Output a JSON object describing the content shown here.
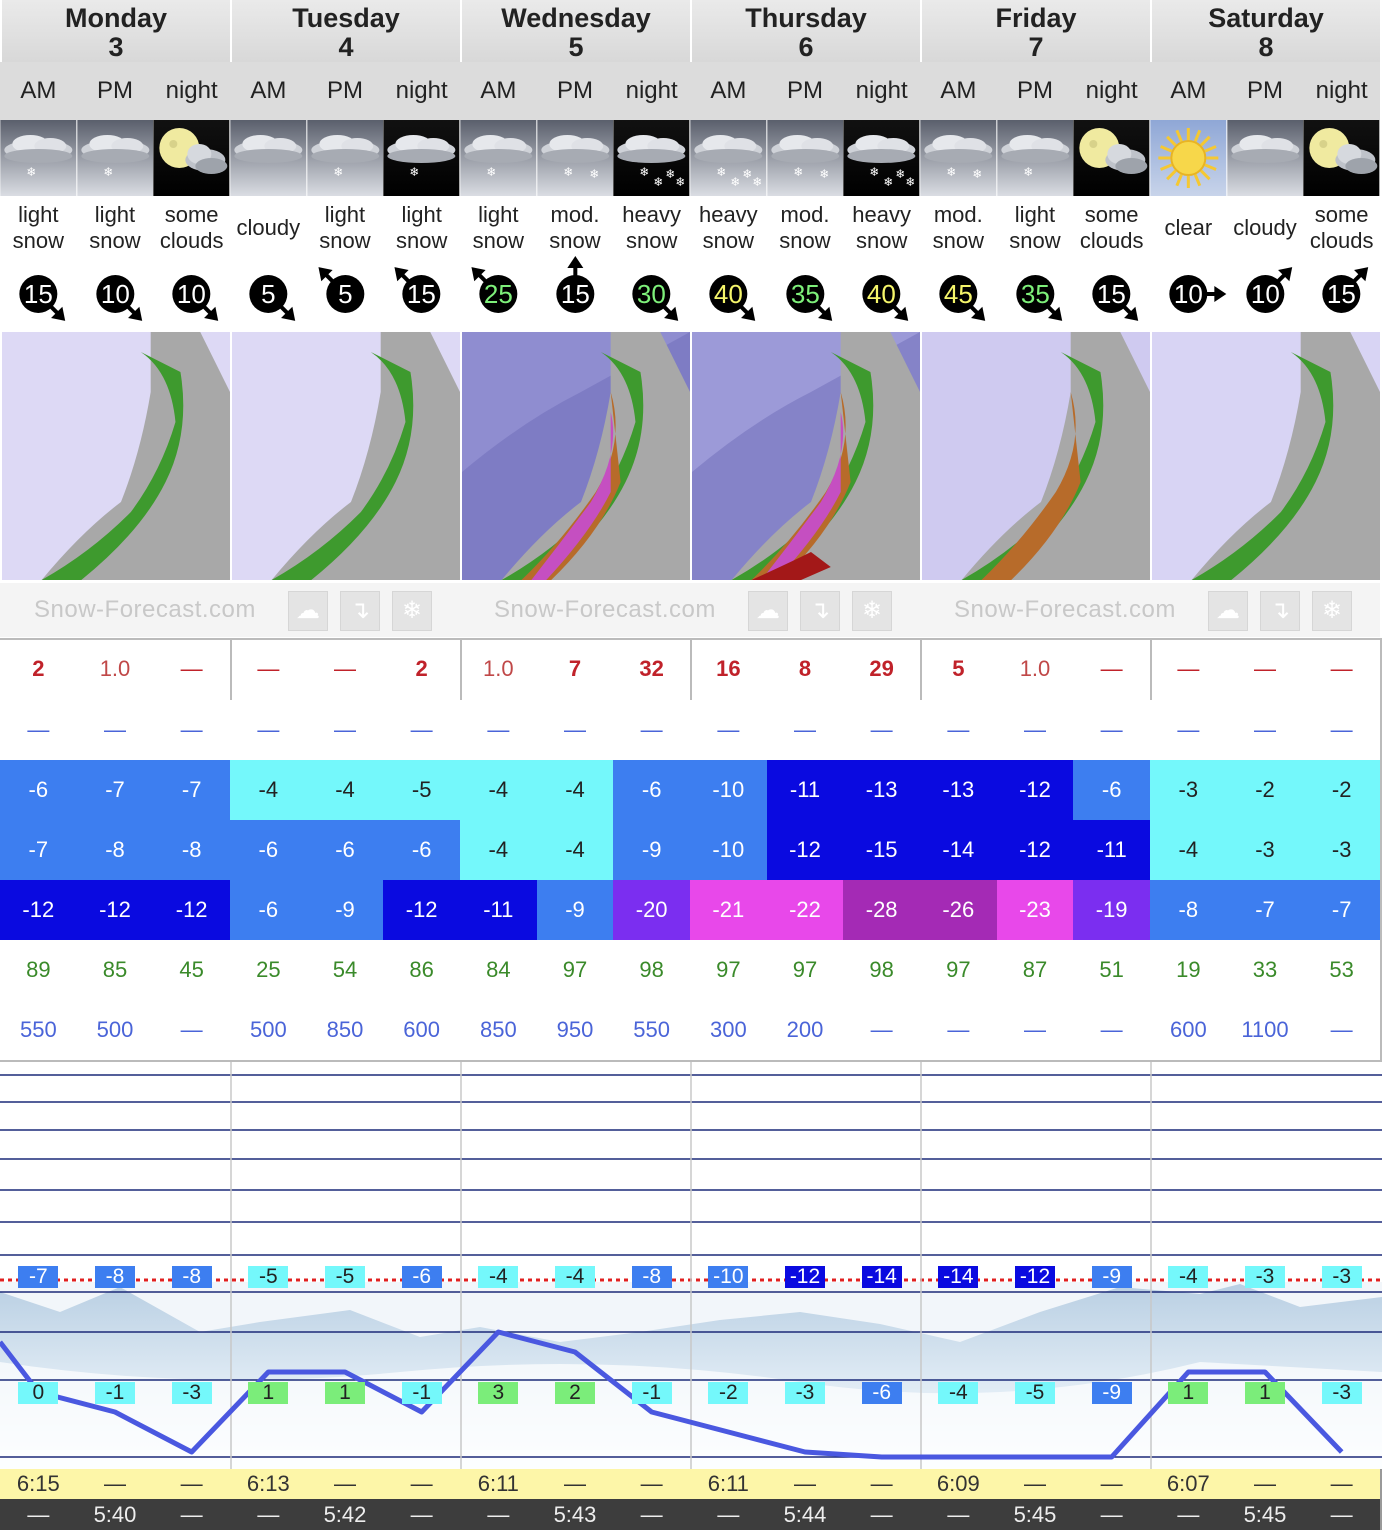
{
  "days": [
    {
      "name": "Monday",
      "date": "3",
      "periods": [
        "AM",
        "PM",
        "night"
      ],
      "weather": [
        "light\nsnow",
        "light\nsnow",
        "some\nclouds"
      ],
      "icons": [
        "light-snow-icon",
        "light-snow-icon",
        "night-clouds-icon"
      ],
      "wind": [
        15,
        10,
        10
      ],
      "wind_dir": [
        "SE",
        "SE",
        "SE"
      ],
      "snow": [
        "2",
        "1.0",
        "—"
      ],
      "rain": [
        "—",
        "—",
        "—"
      ],
      "max_temp": [
        "-6",
        "-7",
        "-7"
      ],
      "min_temp": [
        "-7",
        "-8",
        "-8"
      ],
      "chill": [
        "-12",
        "-12",
        "-12"
      ],
      "humidity": [
        "89",
        "85",
        "45"
      ],
      "freeze": [
        "550",
        "500",
        "—"
      ],
      "summit": [
        "-7",
        "-8",
        "-8"
      ],
      "base": [
        "0",
        "-1",
        "-3"
      ],
      "sunrise": "6:15",
      "sunset": "5:40"
    },
    {
      "name": "Tuesday",
      "date": "4",
      "periods": [
        "AM",
        "PM",
        "night"
      ],
      "weather": [
        "cloudy",
        "light\nsnow",
        "light\nsnow"
      ],
      "icons": [
        "cloudy-icon",
        "light-snow-icon",
        "night-snow-icon"
      ],
      "wind": [
        5,
        5,
        15
      ],
      "wind_dir": [
        "SE",
        "NW",
        "NW"
      ],
      "snow": [
        "—",
        "—",
        "2"
      ],
      "rain": [
        "—",
        "—",
        "—"
      ],
      "max_temp": [
        "-4",
        "-4",
        "-5"
      ],
      "min_temp": [
        "-6",
        "-6",
        "-6"
      ],
      "chill": [
        "-6",
        "-9",
        "-12"
      ],
      "humidity": [
        "25",
        "54",
        "86"
      ],
      "freeze": [
        "500",
        "850",
        "600"
      ],
      "summit": [
        "-5",
        "-5",
        "-6"
      ],
      "base": [
        "1",
        "1",
        "-1"
      ],
      "sunrise": "6:13",
      "sunset": "5:42"
    },
    {
      "name": "Wednesday",
      "date": "5",
      "periods": [
        "AM",
        "PM",
        "night"
      ],
      "weather": [
        "light\nsnow",
        "mod.\nsnow",
        "heavy\nsnow"
      ],
      "icons": [
        "light-snow-icon",
        "mod-snow-icon",
        "night-heavy-snow-icon"
      ],
      "wind": [
        25,
        15,
        30
      ],
      "wind_dir": [
        "NW",
        "N",
        "SE"
      ],
      "snow": [
        "1.0",
        "7",
        "32"
      ],
      "rain": [
        "—",
        "—",
        "—"
      ],
      "max_temp": [
        "-4",
        "-4",
        "-6"
      ],
      "min_temp": [
        "-4",
        "-4",
        "-9"
      ],
      "chill": [
        "-11",
        "-9",
        "-20"
      ],
      "humidity": [
        "84",
        "97",
        "98"
      ],
      "freeze": [
        "850",
        "950",
        "550"
      ],
      "summit": [
        "-4",
        "-4",
        "-8"
      ],
      "base": [
        "3",
        "2",
        "-1"
      ],
      "sunrise": "6:11",
      "sunset": "5:43"
    },
    {
      "name": "Thursday",
      "date": "6",
      "periods": [
        "AM",
        "PM",
        "night"
      ],
      "weather": [
        "heavy\nsnow",
        "mod.\nsnow",
        "heavy\nsnow"
      ],
      "icons": [
        "heavy-snow-icon",
        "mod-snow-icon",
        "night-heavy-snow-icon"
      ],
      "wind": [
        40,
        35,
        40
      ],
      "wind_dir": [
        "SE",
        "SE",
        "SE"
      ],
      "snow": [
        "16",
        "8",
        "29"
      ],
      "rain": [
        "—",
        "—",
        "—"
      ],
      "max_temp": [
        "-10",
        "-11",
        "-13"
      ],
      "min_temp": [
        "-10",
        "-12",
        "-15"
      ],
      "chill": [
        "-21",
        "-22",
        "-28"
      ],
      "humidity": [
        "97",
        "97",
        "98"
      ],
      "freeze": [
        "300",
        "200",
        "—"
      ],
      "summit": [
        "-10",
        "-12",
        "-14"
      ],
      "base": [
        "-2",
        "-3",
        "-6"
      ],
      "sunrise": "6:11",
      "sunset": "5:44"
    },
    {
      "name": "Friday",
      "date": "7",
      "periods": [
        "AM",
        "PM",
        "night"
      ],
      "weather": [
        "mod.\nsnow",
        "light\nsnow",
        "some\nclouds"
      ],
      "icons": [
        "mod-snow-icon",
        "light-snow-icon",
        "night-clouds-icon"
      ],
      "wind": [
        45,
        35,
        15
      ],
      "wind_dir": [
        "SE",
        "SE",
        "SE"
      ],
      "snow": [
        "5",
        "1.0",
        "—"
      ],
      "rain": [
        "—",
        "—",
        "—"
      ],
      "max_temp": [
        "-13",
        "-12",
        "-6"
      ],
      "min_temp": [
        "-14",
        "-12",
        "-11"
      ],
      "chill": [
        "-26",
        "-23",
        "-19"
      ],
      "humidity": [
        "97",
        "87",
        "51"
      ],
      "freeze": [
        "—",
        "—",
        "—"
      ],
      "summit": [
        "-14",
        "-12",
        "-9"
      ],
      "base": [
        "-4",
        "-5",
        "-9"
      ],
      "sunrise": "6:09",
      "sunset": "5:45"
    },
    {
      "name": "Saturday",
      "date": "8",
      "periods": [
        "AM",
        "PM",
        "night"
      ],
      "weather": [
        "clear",
        "cloudy",
        "some\nclouds"
      ],
      "icons": [
        "sun-icon",
        "cloudy-icon",
        "night-clouds-icon"
      ],
      "wind": [
        10,
        10,
        15
      ],
      "wind_dir": [
        "E",
        "NE",
        "NE"
      ],
      "snow": [
        "—",
        "—",
        "—"
      ],
      "rain": [
        "—",
        "—",
        "—"
      ],
      "max_temp": [
        "-3",
        "-2",
        "-2"
      ],
      "min_temp": [
        "-4",
        "-3",
        "-3"
      ],
      "chill": [
        "-8",
        "-7",
        "-7"
      ],
      "humidity": [
        "19",
        "33",
        "53"
      ],
      "freeze": [
        "600",
        "1100",
        "—"
      ],
      "summit": [
        "-4",
        "-3",
        "-3"
      ],
      "base": [
        "1",
        "1",
        "-3"
      ],
      "sunrise": "6:07",
      "sunset": "5:45"
    }
  ],
  "brand": "Snow-Forecast.com",
  "colors": {
    "temp_cyan": "#74f8fb",
    "temp_mid": "#3d7ef0",
    "temp_deep": "#0a0ae0",
    "temp_violet": "#7b2ef0",
    "temp_magenta": "#e848ea",
    "temp_purple": "#a42ab5",
    "humidity": "#3a8a2a",
    "freeze": "#4a64d8",
    "snow_red": "#c0222a"
  }
}
